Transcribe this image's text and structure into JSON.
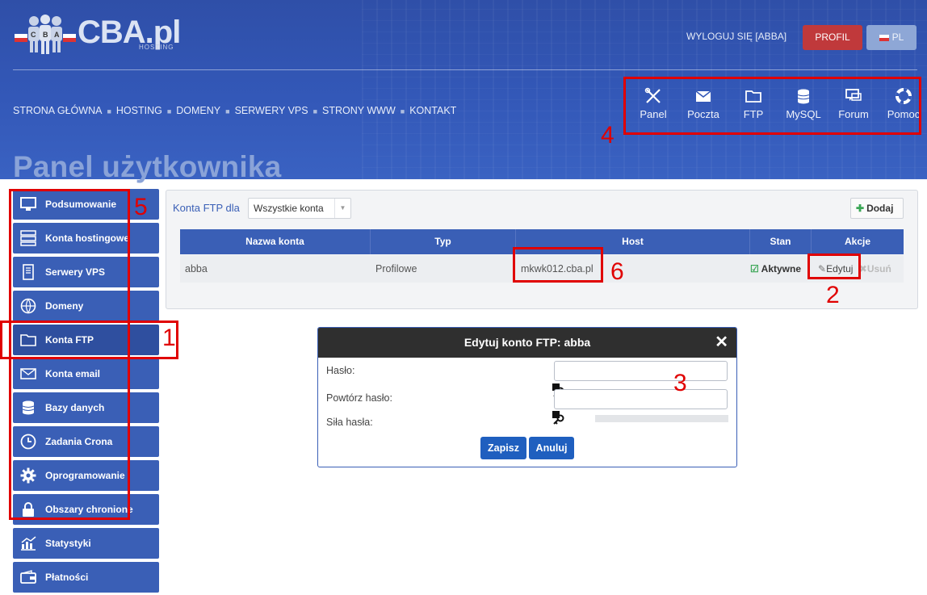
{
  "brand": {
    "name": "CBA.pl",
    "tagline": "HOSTING"
  },
  "header": {
    "logout": "WYLOGUJ SIĘ [ABBA]",
    "profile_button": "PROFIL",
    "lang_button": "PL"
  },
  "top_nav": [
    "STRONA GŁÓWNA",
    "HOSTING",
    "DOMENY",
    "SERWERY VPS",
    "STRONY WWW",
    "KONTAKT"
  ],
  "icon_bar": [
    {
      "label": "Panel",
      "icon": "tools-icon"
    },
    {
      "label": "Poczta",
      "icon": "mail-icon"
    },
    {
      "label": "FTP",
      "icon": "folder-icon"
    },
    {
      "label": "MySQL",
      "icon": "database-icon"
    },
    {
      "label": "Forum",
      "icon": "chat-icon"
    },
    {
      "label": "Pomoc",
      "icon": "lifebuoy-icon"
    }
  ],
  "page_title": "Panel użytkownika",
  "sidebar": [
    {
      "label": "Podsumowanie",
      "icon": "monitor-icon"
    },
    {
      "label": "Konta hostingowe",
      "icon": "server-icon"
    },
    {
      "label": "Serwery VPS",
      "icon": "vps-icon"
    },
    {
      "label": "Domeny",
      "icon": "globe-icon"
    },
    {
      "label": "Konta FTP",
      "icon": "folder-icon",
      "active": true
    },
    {
      "label": "Konta email",
      "icon": "mail-icon"
    },
    {
      "label": "Bazy danych",
      "icon": "database-icon"
    },
    {
      "label": "Zadania Crona",
      "icon": "clock-icon"
    },
    {
      "label": "Oprogramowanie",
      "icon": "gear-icon"
    },
    {
      "label": "Obszary chronione",
      "icon": "lock-icon"
    },
    {
      "label": "Statystyki",
      "icon": "chart-icon"
    },
    {
      "label": "Płatności",
      "icon": "wallet-icon"
    }
  ],
  "ftp": {
    "label": "Konta FTP dla",
    "select_value": "Wszystkie konta",
    "add_button": "Dodaj",
    "columns": [
      "Nazwa konta",
      "Typ",
      "Host",
      "Stan",
      "Akcje"
    ],
    "rows": [
      {
        "name": "abba",
        "type": "Profilowe",
        "host": "mkwk012.cba.pl",
        "status": "Aktywne",
        "edit": "Edytuj",
        "delete": "Usuń"
      }
    ]
  },
  "modal": {
    "title": "Edytuj konto FTP: abba",
    "password_label": "Hasło:",
    "repeat_label": "Powtórz hasło:",
    "strength_label": "Siła hasła:",
    "save_button": "Zapisz",
    "cancel_button": "Anuluj"
  },
  "annotations": [
    "1",
    "2",
    "3",
    "4",
    "5",
    "6"
  ],
  "colors": {
    "accent": "#3a5fb6",
    "danger": "#c0393b",
    "annotation": "#e00000"
  }
}
